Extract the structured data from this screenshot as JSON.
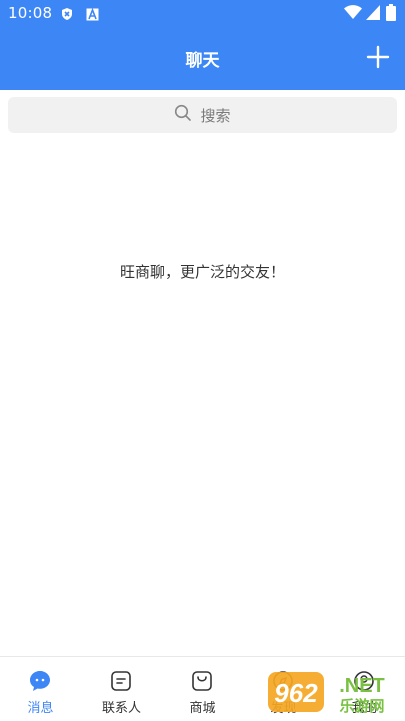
{
  "status_bar": {
    "time": "10:08"
  },
  "header": {
    "title": "聊天",
    "add_icon": "plus-icon"
  },
  "search": {
    "placeholder": "搜索",
    "icon": "search-icon"
  },
  "main": {
    "empty_message": "旺商聊，更广泛的交友！"
  },
  "tabs": [
    {
      "label": "消息",
      "icon": "chat-bubble-icon",
      "active": true
    },
    {
      "label": "联系人",
      "icon": "contacts-icon",
      "active": false
    },
    {
      "label": "商城",
      "icon": "shopping-bag-icon",
      "active": false
    },
    {
      "label": "发现",
      "icon": "discover-icon",
      "active": false
    },
    {
      "label": "我的",
      "icon": "profile-icon",
      "active": false
    }
  ],
  "watermark": {
    "text": "962.NET",
    "subtext": "乐游网"
  },
  "colors": {
    "primary": "#3d86f6",
    "background": "#ffffff",
    "search_bg": "#f1f1f1"
  }
}
